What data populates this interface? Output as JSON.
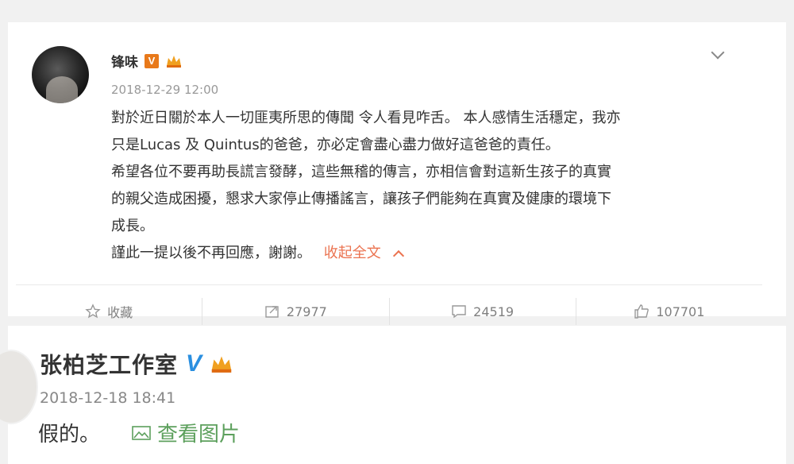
{
  "post1": {
    "author": "锋味",
    "timestamp": "2018-12-29 12:00",
    "paragraphs": [
      "對於近日關於本人一切匪夷所思的傳聞 令人看見咋舌。 本人感情生活穩定，我亦",
      "只是Lucas 及 Quintus的爸爸，亦必定會盡心盡力做好這爸爸的責任。",
      "希望各位不要再助長謊言發酵，這些無稽的傳言，亦相信會對這新生孩子的真實",
      "的親父造成困擾，懇求大家停止傳播謠言，讓孩子們能夠在真實及健康的環境下",
      "成長。"
    ],
    "last_line": "謹此一提以後不再回應，謝謝。",
    "collapse_label": "收起全文",
    "actions": {
      "favorite_label": "收藏",
      "repost_count": "27977",
      "comment_count": "24519",
      "like_count": "107701"
    }
  },
  "post2": {
    "author": "张柏芝工作室",
    "verified_mark": "V",
    "timestamp": "2018-12-18 18:41",
    "text": "假的。",
    "view_image_label": "查看图片"
  },
  "colors": {
    "verified_orange": "#e8791a",
    "verified_blue": "#2a8fe0",
    "collapse_link": "#eb7350",
    "view_image_link": "#5da05d"
  },
  "icons": [
    "vip-badge-icon",
    "crown-icon",
    "chevron-down-icon",
    "star-icon",
    "repost-icon",
    "comment-icon",
    "thumb-up-icon",
    "image-icon",
    "chevron-up-icon"
  ]
}
